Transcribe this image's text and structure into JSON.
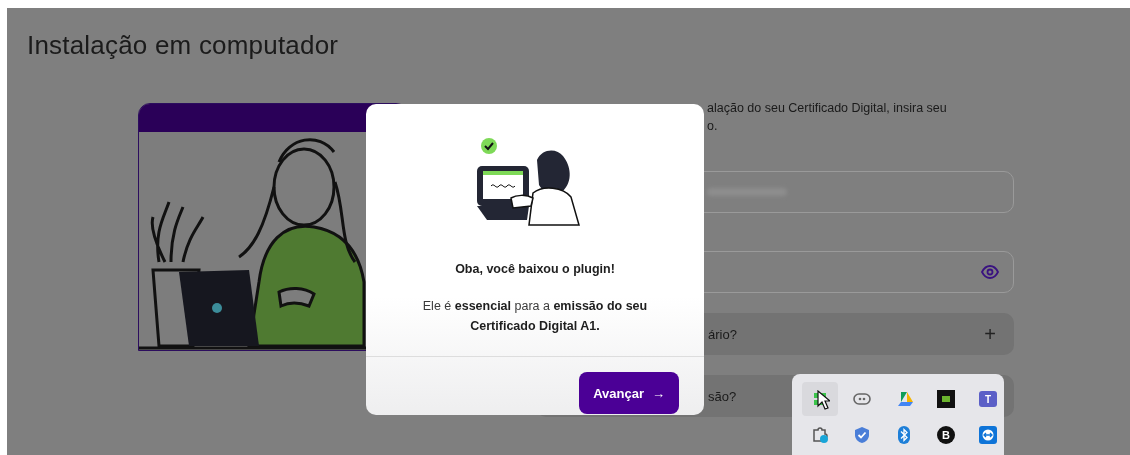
{
  "page": {
    "title": "Instalação em computador"
  },
  "intro_lines": [
    "alação do seu Certificado Digital, insira seu",
    "o."
  ],
  "fields": [
    {
      "kind": "text"
    },
    {
      "kind": "password"
    }
  ],
  "accordion": [
    {
      "label": "ário?",
      "icon": "+"
    },
    {
      "label": "são?"
    }
  ],
  "modal": {
    "title": "Oba, você baixou o plugin!",
    "message": "Ele é **essencial** para a **emissão do seu Certificado Digital A1.**",
    "button": {
      "label": "Avançar",
      "arrow": "→"
    }
  },
  "tray": {
    "icons": [
      {
        "kind": "app",
        "highlighted": true
      },
      {
        "kind": "controller",
        "highlighted": false
      },
      {
        "kind": "drive",
        "highlighted": false
      },
      {
        "kind": "chip",
        "highlighted": false
      },
      {
        "kind": "team",
        "label": "T",
        "highlighted": false
      },
      {
        "kind": "puzzle",
        "highlighted": false
      },
      {
        "kind": "shield",
        "highlighted": false
      },
      {
        "kind": "bluetooth",
        "highlighted": false
      },
      {
        "kind": "letter",
        "label": "B",
        "highlighted": false
      },
      {
        "kind": "remote",
        "highlighted": false
      }
    ]
  }
}
